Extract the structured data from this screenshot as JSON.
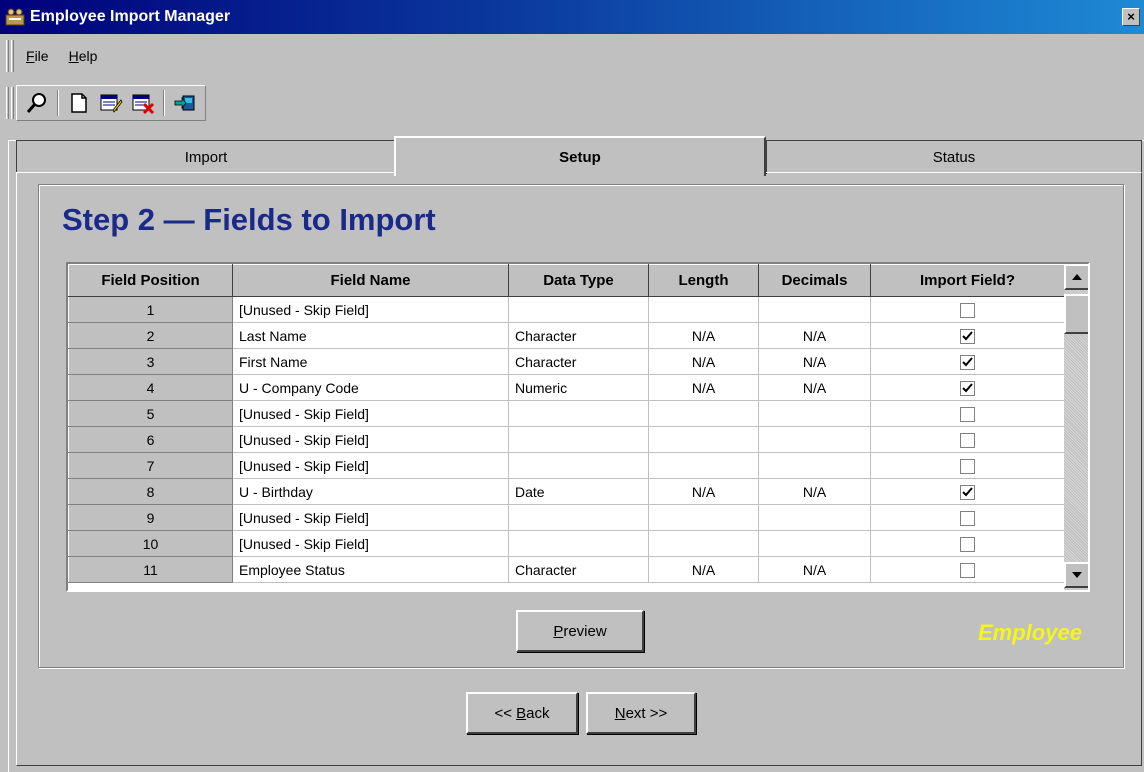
{
  "window": {
    "title": "Employee Import Manager",
    "close_label": "×"
  },
  "menu": {
    "file": {
      "accel": "F",
      "rest": "ile"
    },
    "help": {
      "accel": "H",
      "rest": "elp"
    }
  },
  "toolbar": {
    "icons": [
      "search-icon",
      "new-document-icon",
      "edit-list-icon",
      "delete-list-icon",
      "export-icon"
    ]
  },
  "tabs": [
    {
      "label": "Import",
      "active": false
    },
    {
      "label": "Setup",
      "active": true
    },
    {
      "label": "Status",
      "active": false
    }
  ],
  "step_title": "Step 2 — Fields to Import",
  "grid": {
    "headers": [
      "Field Position",
      "Field Name",
      "Data Type",
      "Length",
      "Decimals",
      "Import Field?"
    ],
    "rows": [
      {
        "position": "1",
        "name": "[Unused - Skip Field]",
        "type": "",
        "length": "",
        "decimals": "",
        "import": false
      },
      {
        "position": "2",
        "name": "Last Name",
        "type": "Character",
        "length": "N/A",
        "decimals": "N/A",
        "import": true
      },
      {
        "position": "3",
        "name": "First Name",
        "type": "Character",
        "length": "N/A",
        "decimals": "N/A",
        "import": true
      },
      {
        "position": "4",
        "name": "U - Company Code",
        "type": "Numeric",
        "length": "N/A",
        "decimals": "N/A",
        "import": true
      },
      {
        "position": "5",
        "name": "[Unused - Skip Field]",
        "type": "",
        "length": "",
        "decimals": "",
        "import": false
      },
      {
        "position": "6",
        "name": "[Unused - Skip Field]",
        "type": "",
        "length": "",
        "decimals": "",
        "import": false
      },
      {
        "position": "7",
        "name": "[Unused - Skip Field]",
        "type": "",
        "length": "",
        "decimals": "",
        "import": false
      },
      {
        "position": "8",
        "name": "U - Birthday",
        "type": "Date",
        "length": "N/A",
        "decimals": "N/A",
        "import": true
      },
      {
        "position": "9",
        "name": "[Unused - Skip Field]",
        "type": "",
        "length": "",
        "decimals": "",
        "import": false
      },
      {
        "position": "10",
        "name": "[Unused - Skip Field]",
        "type": "",
        "length": "",
        "decimals": "",
        "import": false
      },
      {
        "position": "11",
        "name": "Employee Status",
        "type": "Character",
        "length": "N/A",
        "decimals": "N/A",
        "import": false
      }
    ]
  },
  "buttons": {
    "preview": {
      "accel": "P",
      "rest": "review"
    },
    "back": {
      "prefix": "<< ",
      "accel": "B",
      "rest": "ack"
    },
    "next": {
      "accel": "N",
      "rest": "ext >>"
    }
  },
  "watermark": "Employee"
}
